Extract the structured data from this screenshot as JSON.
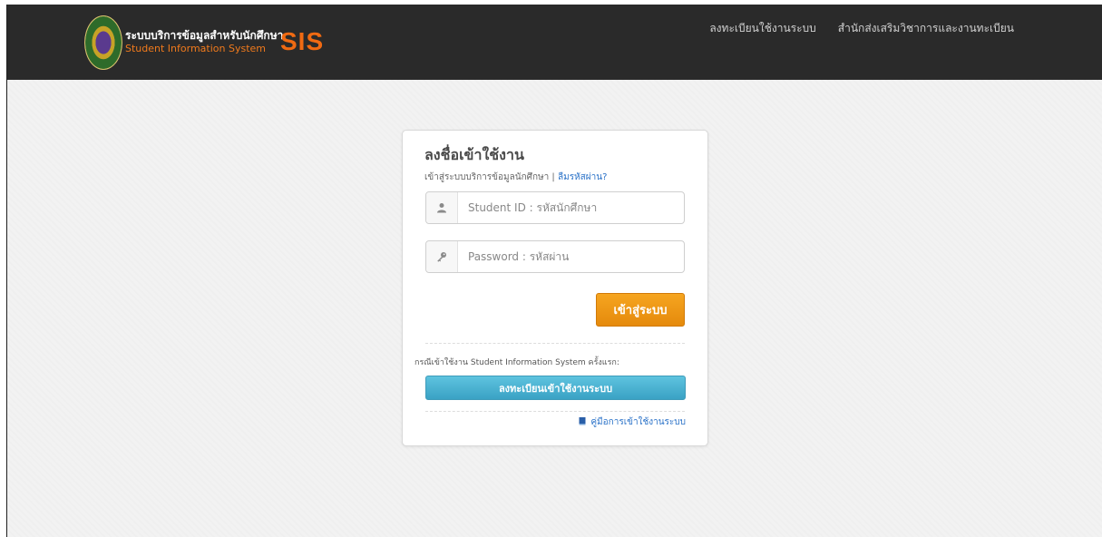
{
  "header": {
    "logo_text_th": "ระบบบริการข้อมูลสำหรับนักศึกษา",
    "logo_text_en": "Student Information System",
    "logo_abbr": "SIS",
    "nav": [
      {
        "label": "ลงทะเบียนใช้งานระบบ"
      },
      {
        "label": "สำนักส่งเสริมวิชาการและงานทะเบียน"
      }
    ]
  },
  "login": {
    "title": "ลงชื่อเข้าใช้งาน",
    "subtitle": "เข้าสู่ระบบบริการข้อมูลนักศึกษา |",
    "forgot_link": "ลืมรหัสผ่าน?",
    "student_id": {
      "placeholder": "Student ID : รหัสนักศึกษา",
      "icon": "user-icon"
    },
    "password": {
      "placeholder": "Password : รหัสผ่าน",
      "icon": "key-icon"
    },
    "submit_label": "เข้าสู่ระบบ",
    "first_time_note": "กรณีเข้าใช้งาน Student Information System ครั้งแรก:",
    "register_label": "ลงทะเบียนเข้าใช้งานระบบ",
    "manual_link": "คู่มือการเข้าใช้งานระบบ",
    "manual_icon": "book-icon"
  },
  "colors": {
    "topbar": "#2a2a2a",
    "accent_orange": "#f06a12",
    "login_button": "#f29a1a",
    "register_button": "#4db3d4",
    "link": "#2a72c8"
  }
}
